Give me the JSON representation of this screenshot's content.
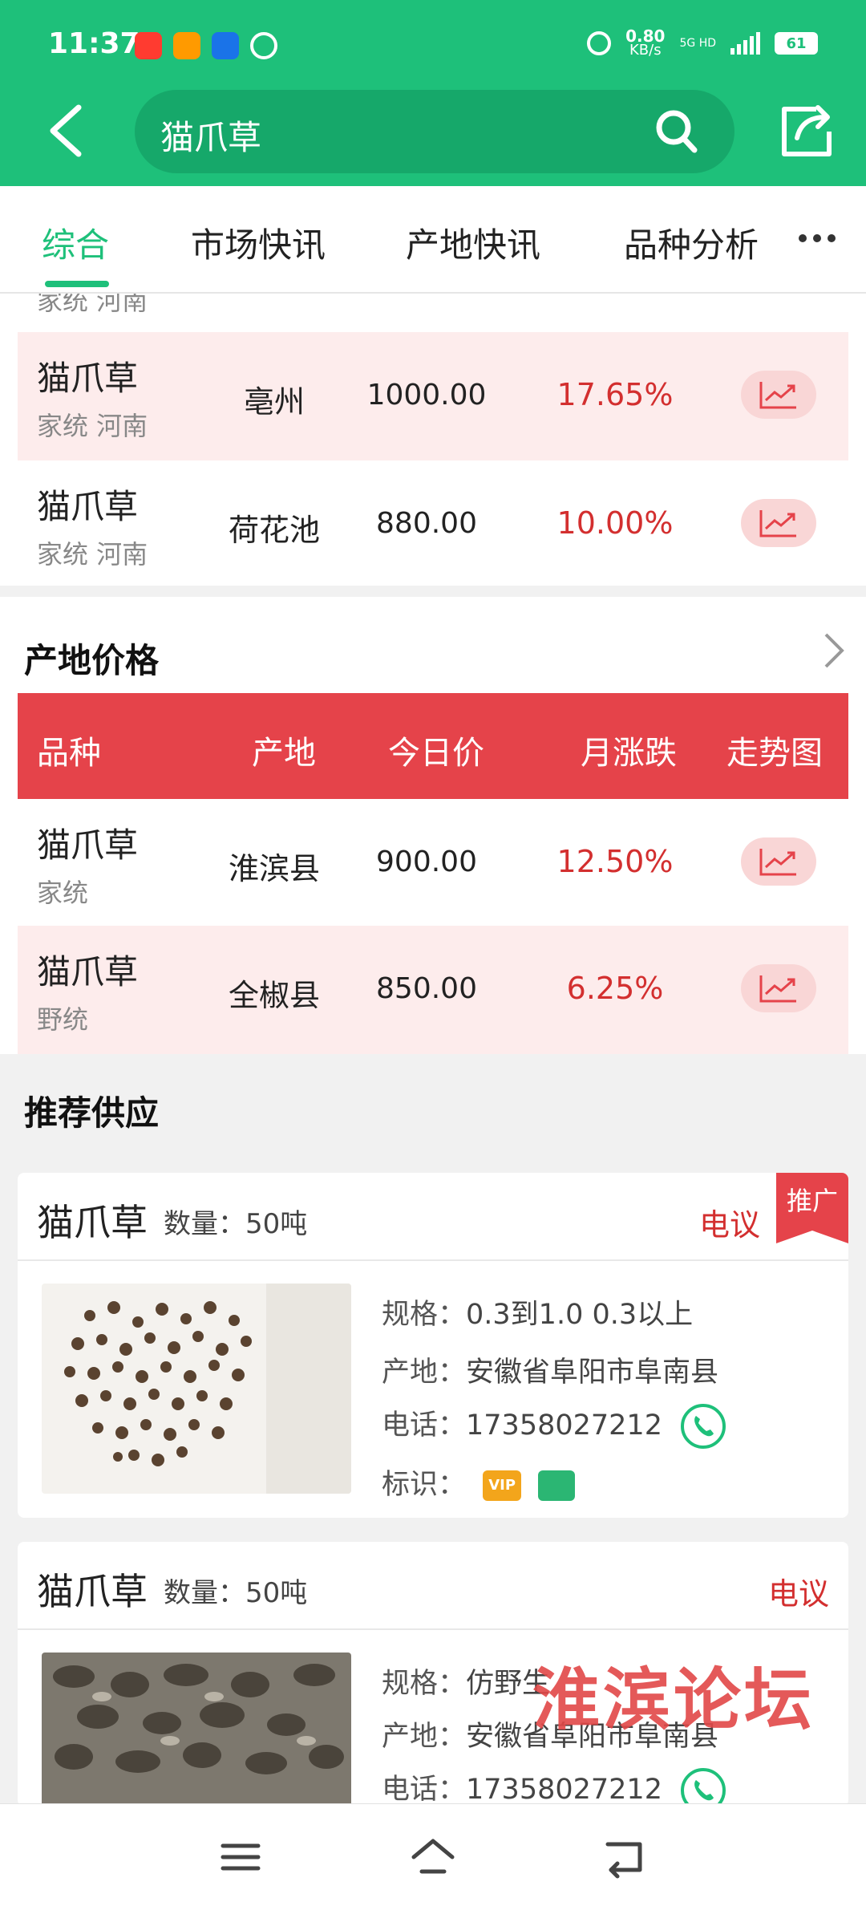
{
  "status_bar": {
    "time": "11:37",
    "net_speed": "0.80",
    "net_unit": "KB/s",
    "net_type": "5G HD",
    "battery": "61",
    "app_icons": [
      "taobao-icon",
      "app-icon",
      "app-icon",
      "app-icon"
    ]
  },
  "header": {
    "search_value": "猫爪草",
    "colors": {
      "brand": "#1ec07a",
      "accent": "#e5434a"
    }
  },
  "tabs": {
    "items": [
      {
        "label": "综合",
        "active": true
      },
      {
        "label": "市场快讯",
        "active": false
      },
      {
        "label": "产地快讯",
        "active": false
      },
      {
        "label": "品种分析",
        "active": false
      }
    ]
  },
  "market_rows": {
    "partial_sub": "家统 河南",
    "rows": [
      {
        "name": "猫爪草",
        "sub": "家统 河南",
        "place": "亳州",
        "price": "1000.00",
        "pct": "17.65%"
      },
      {
        "name": "猫爪草",
        "sub": "家统 河南",
        "place": "荷花池",
        "price": "880.00",
        "pct": "10.00%"
      }
    ]
  },
  "origin_price": {
    "title": "产地价格",
    "headers": {
      "variety": "品种",
      "origin": "产地",
      "today": "今日价",
      "month": "月涨跌",
      "trend": "走势图"
    },
    "rows": [
      {
        "name": "猫爪草",
        "sub": "家统",
        "place": "淮滨县",
        "price": "900.00",
        "pct": "12.50%"
      },
      {
        "name": "猫爪草",
        "sub": "野统",
        "place": "全椒县",
        "price": "850.00",
        "pct": "6.25%"
      }
    ]
  },
  "supply": {
    "title": "推荐供应",
    "cards": [
      {
        "name": "猫爪草",
        "qty": "数量：50吨",
        "price": "电议",
        "ribbon": "推广",
        "spec_label": "规格：",
        "spec": "0.3到1.0 0.3以上",
        "origin_label": "产地：",
        "origin": "安徽省阜阳市阜南县",
        "phone_label": "电话：",
        "phone": "17358027212",
        "mark_label": "标识：",
        "vip": "VIP"
      },
      {
        "name": "猫爪草",
        "qty": "数量：50吨",
        "price": "电议",
        "spec_label": "规格：",
        "spec": "仿野生",
        "origin_label": "产地：",
        "origin": "安徽省阜阳市阜南县",
        "phone_label": "电话：",
        "phone": "17358027212"
      }
    ]
  },
  "watermark": "淮滨论坛"
}
